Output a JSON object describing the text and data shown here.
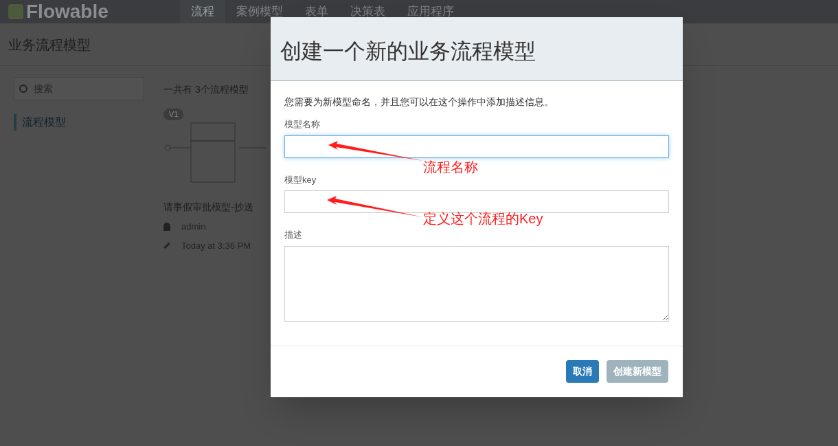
{
  "navbar": {
    "logo": "Flowable",
    "items": [
      {
        "label": "流程",
        "selected": true
      },
      {
        "label": "案例模型",
        "selected": false
      },
      {
        "label": "表单",
        "selected": false
      },
      {
        "label": "决策表",
        "selected": false
      },
      {
        "label": "应用程序",
        "selected": false
      }
    ]
  },
  "page": {
    "title": "业务流程模型",
    "search": {
      "placeholder": "搜索"
    },
    "sidebar": [
      {
        "label": "流程模型",
        "selected": true
      }
    ],
    "count": "一共有 3个流程模型",
    "card": {
      "badge": "V1",
      "name": "请事假审批模型-抄送",
      "owner": "admin",
      "modified": "Today at 3:36 PM"
    }
  },
  "dialog": {
    "title": "创建一个新的业务流程模型",
    "intro": "您需要为新模型命名，并且您可以在这个操作中添加描述信息。",
    "fields": [
      {
        "kind": "input",
        "label": "模型名称",
        "focused": true
      },
      {
        "kind": "input",
        "label": "模型key",
        "focused": false
      },
      {
        "kind": "textarea",
        "label": "描述",
        "focused": false
      }
    ],
    "buttons": [
      {
        "label": "取消",
        "disabled": false
      },
      {
        "label": "创建新模型",
        "disabled": true
      }
    ]
  },
  "annotations": [
    {
      "text": "流程名称"
    },
    {
      "text": "定义这个流程的Key"
    }
  ]
}
